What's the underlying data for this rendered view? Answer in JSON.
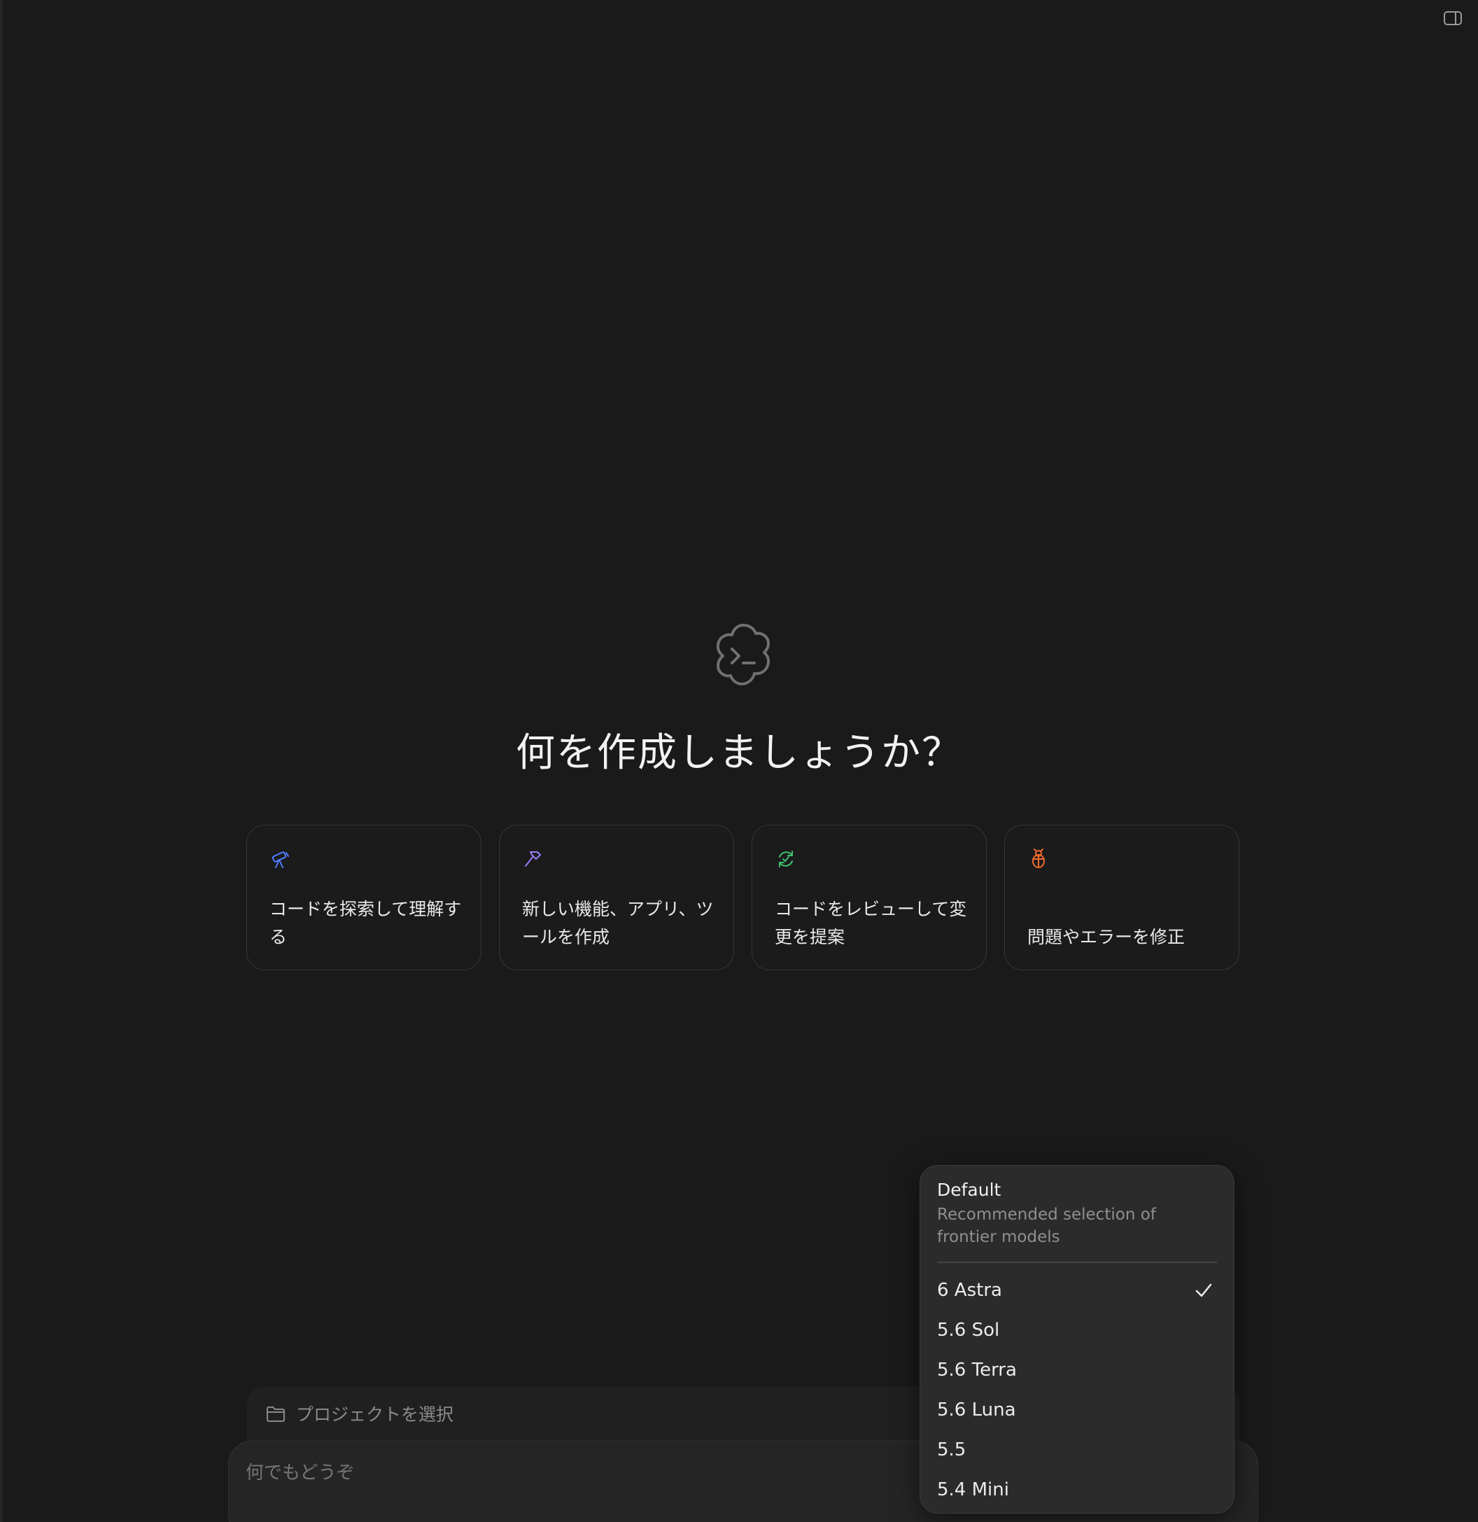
{
  "heading": "何を作成しましょうか？",
  "cards": [
    {
      "label": "コードを探索して理解する",
      "icon": "telescope-icon",
      "color": "#4f7cff"
    },
    {
      "label": "新しい機能、アプリ、ツールを作成",
      "icon": "hammer-icon",
      "color": "#9a7bff"
    },
    {
      "label": "コードをレビューして変更を提案",
      "icon": "review-cycle-icon",
      "color": "#3fbf6f"
    },
    {
      "label": "問題やエラーを修正",
      "icon": "bug-icon",
      "color": "#f06a2c"
    }
  ],
  "project_bar": {
    "label": "プロジェクトを選択"
  },
  "composer": {
    "placeholder": "何でもどうぞ"
  },
  "model_menu": {
    "default_title": "Default",
    "default_description": "Recommended selection of frontier models",
    "items": [
      "6 Astra",
      "5.6 Sol",
      "5.6 Terra",
      "5.6 Luna",
      "5.5",
      "5.4 Mini"
    ],
    "selected": "6 Astra"
  }
}
